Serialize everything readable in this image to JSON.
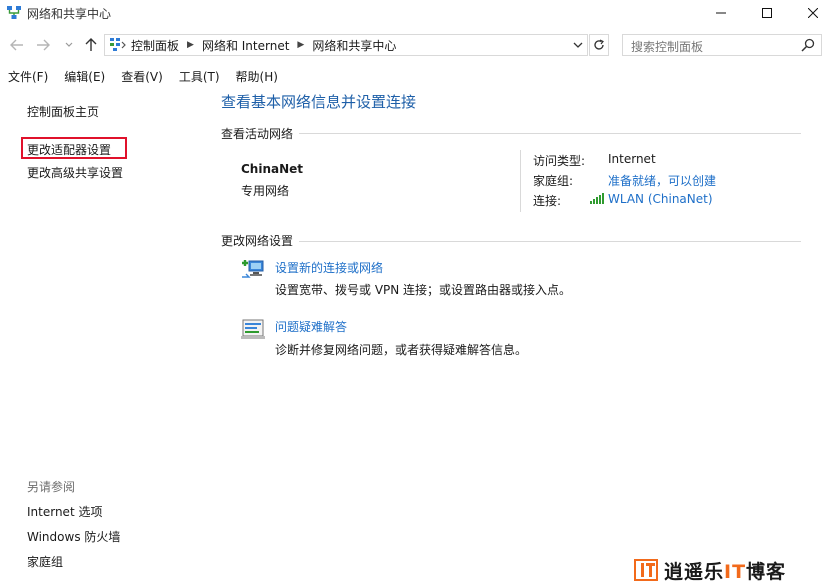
{
  "window": {
    "title": "网络和共享中心",
    "icons": [
      "network-center-icon",
      "minimize-icon",
      "maximize-icon",
      "close-icon"
    ]
  },
  "navigation": {
    "breadcrumbs": [
      "控制面板",
      "网络和 Internet",
      "网络和共享中心"
    ],
    "search_placeholder": "搜索控制面板",
    "icons": [
      "back-arrow-icon",
      "forward-arrow-icon",
      "recent-dropdown-icon",
      "up-arrow-icon",
      "control-panel-icon",
      "refresh-icon",
      "search-icon"
    ]
  },
  "menu": {
    "items": [
      "文件(F)",
      "编辑(E)",
      "查看(V)",
      "工具(T)",
      "帮助(H)"
    ]
  },
  "sidebar": {
    "links": [
      "控制面板主页",
      "更改适配器设置",
      "更改高级共享设置"
    ],
    "highlighted": "更改适配器设置",
    "highlight_color": "#e0112b",
    "see_also_label": "另请参阅",
    "see_also_links": [
      "Internet 选项",
      "Windows 防火墙",
      "家庭组"
    ]
  },
  "main": {
    "title": "查看基本网络信息并设置连接",
    "active_networks_heading": "查看活动网络",
    "network": {
      "name": "ChinaNet",
      "type": "专用网络",
      "access_type_label": "访问类型:",
      "access_type_value": "Internet",
      "homegroup_label": "家庭组:",
      "homegroup_value": "准备就绪，可以创建",
      "connection_label": "连接:",
      "connection_value": "WLAN (ChinaNet)",
      "connection_icon": "wifi-signal-icon"
    },
    "change_settings_heading": "更改网络设置",
    "tasks": [
      {
        "link": "设置新的连接或网络",
        "description": "设置宽带、拨号或 VPN 连接；或设置路由器或接入点。",
        "icon": "new-connection-icon"
      },
      {
        "link": "问题疑难解答",
        "description": "诊断并修复网络问题，或者获得疑难解答信息。",
        "icon": "troubleshoot-icon"
      }
    ],
    "link_color": "#1e6fc8",
    "title_color": "#1e5fa8"
  },
  "watermark": {
    "text_part1": "逍遥乐",
    "text_accent": "IT",
    "text_part2": "博客",
    "accent_color": "#f26a1b"
  }
}
